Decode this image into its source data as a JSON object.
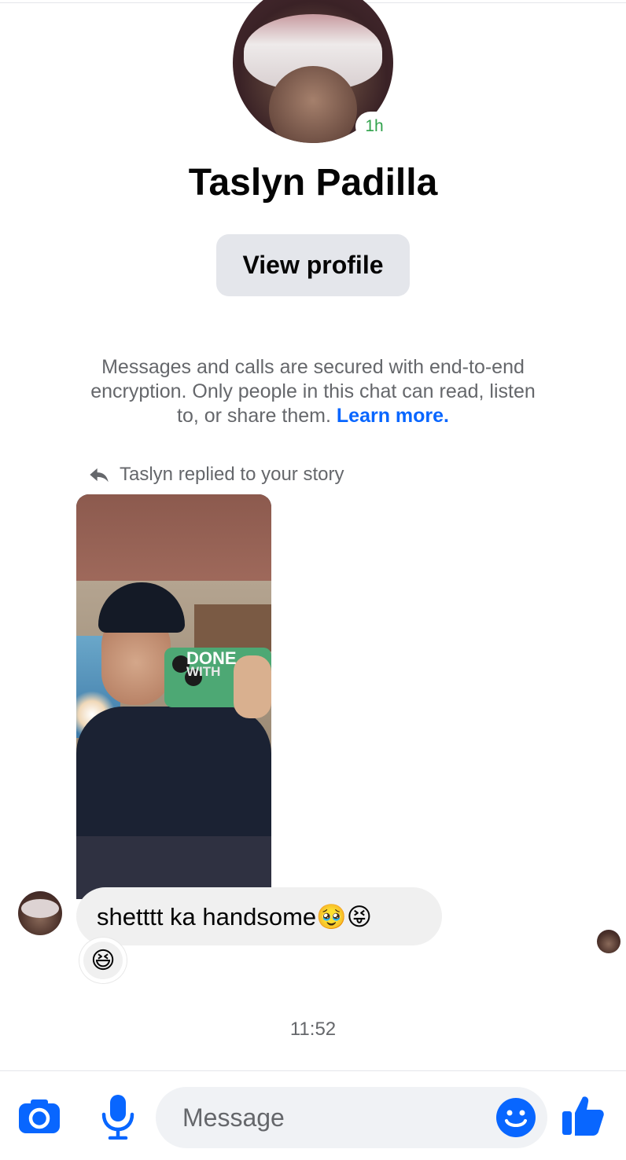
{
  "header": {
    "contact_name": "Taslyn Padilla",
    "active_status": "1h",
    "view_profile_label": "View profile",
    "encryption_notice": "Messages and calls are secured with end-to-end encryption. Only people in this chat can read, listen to, or share them.",
    "learn_more_label": "Learn more."
  },
  "thread": {
    "reply_label": "Taslyn replied to your story",
    "story_sticker_line1": "DONE",
    "story_sticker_line2": "WITH",
    "message_text": "shetttt ka handsome🥹😝",
    "reaction_emoji": "😆",
    "timestamp": "11:52"
  },
  "composer": {
    "placeholder": "Message",
    "icons": [
      "camera-icon",
      "microphone-icon",
      "emoji-icon",
      "thumbs-up-icon"
    ]
  },
  "colors": {
    "accent": "#0866ff",
    "active_green": "#31a24c",
    "bubble_gray": "#f0f0f0",
    "secondary_text": "#65676b"
  }
}
